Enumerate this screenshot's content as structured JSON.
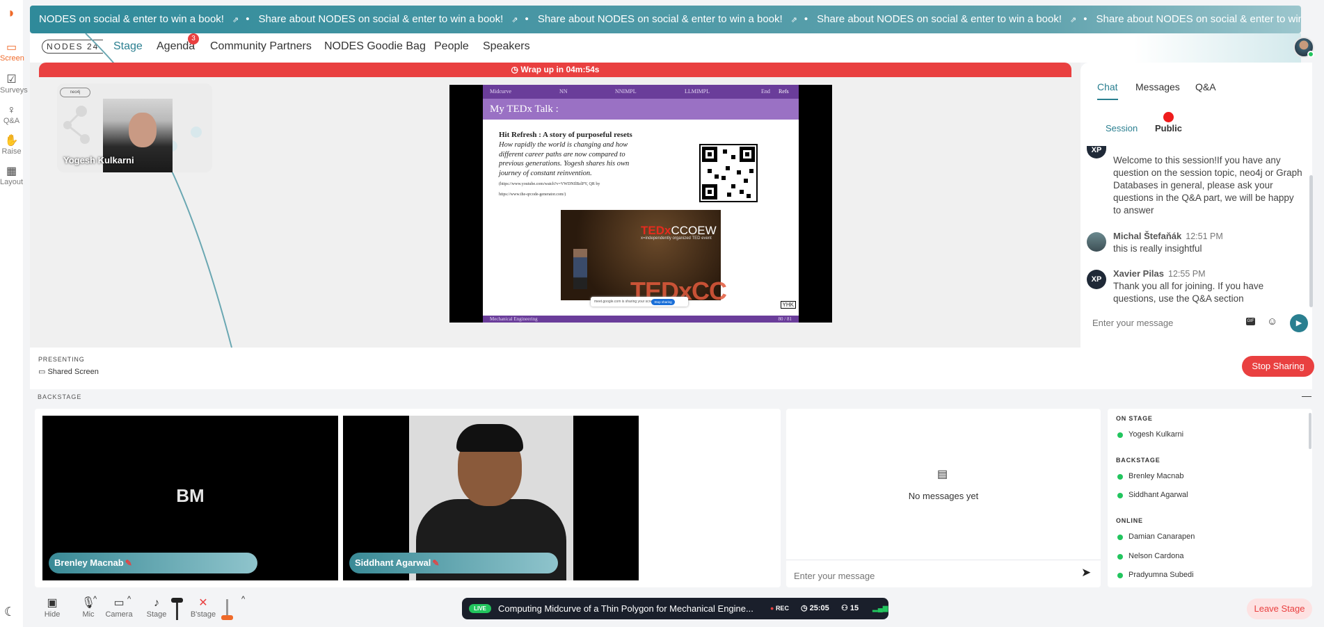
{
  "ticker": {
    "items": [
      "NODES on social & enter to win a book!",
      "Share about NODES on social & enter to win a book!",
      "Share about NODES on social & enter to win a book!",
      "Share about NODES on social & enter to win a book!",
      "Share about NODES on social & enter to win a book!"
    ]
  },
  "rail": {
    "items": [
      {
        "label": "Screen",
        "icon": "screen-icon"
      },
      {
        "label": "Surveys",
        "icon": "surveys-icon"
      },
      {
        "label": "Q&A",
        "icon": "qa-icon"
      },
      {
        "label": "Raise",
        "icon": "hand-icon"
      },
      {
        "label": "Layout",
        "icon": "layout-icon"
      }
    ]
  },
  "header": {
    "logo": "NODES 24",
    "nav": [
      "Stage",
      "Agenda",
      "Community Partners",
      "NODES Goodie Bag",
      "People",
      "Speakers"
    ],
    "agenda_badge": "3"
  },
  "stage": {
    "wrap_up": "Wrap up in 04m:54s",
    "presenter_name": "Yogesh Kulkarni",
    "slide": {
      "top_nav": [
        "Midcurve",
        "NN",
        "NNIMPL",
        "LLMIMPL",
        "End",
        "Refs"
      ],
      "title": "My TEDx Talk :",
      "heading": "Hit Refresh : A story of purposeful resets",
      "body": "How rapidly the world is changing and how different career paths are now compared to previous generations. Yogesh shares his own journey of constant reinvention.",
      "link1": "(https://www.youtube.com/watch?v=VWDNIlBzlPY, QR by",
      "link2": "https://www.the-qrcode-generator.com/)",
      "ted_logo": "TEDx",
      "ted_name": "CCOEW",
      "ted_sub": "x=independently organized TED event",
      "ted_stage": "TEDxCC",
      "share_text": "meet.google.com is sharing your screen",
      "share_btn": "Stop sharing",
      "footer_left": "Mechanical Engineering",
      "footer_right": "80 / 81",
      "corner": "YHK"
    }
  },
  "chat": {
    "tabs": [
      "Chat",
      "Messages",
      "Q&A"
    ],
    "subtabs": [
      "Session",
      "Public"
    ],
    "messages": [
      {
        "initials": "XP",
        "name": "",
        "time": "",
        "text": "Welcome to this session!If you have any question on the session topic, neo4j or Graph Databases in general, please ask your questions in the Q&A part, we will be happy to answer"
      },
      {
        "initials": "",
        "name": "Michal Štefaňák",
        "time": "12:51 PM",
        "text": "this is really insightful"
      },
      {
        "initials": "XP",
        "name": "Xavier Pilas",
        "time": "12:55 PM",
        "text": "Thank you all for joining. If you have questions, use the Q&A section"
      }
    ],
    "input_placeholder": "Enter your message",
    "gif": "GIF"
  },
  "presenting": {
    "label": "PRESENTING",
    "value": "Shared Screen",
    "stop_btn": "Stop Sharing"
  },
  "backstage": {
    "label": "BACKSTAGE",
    "tiles": [
      {
        "initials": "BM",
        "name": "Brenley Macnab"
      },
      {
        "initials": "",
        "name": "Siddhant Agarwal"
      }
    ],
    "no_messages": "No messages yet",
    "input_placeholder": "Enter your message",
    "people": {
      "on_stage_label": "ON STAGE",
      "on_stage": [
        "Yogesh Kulkarni"
      ],
      "backstage_label": "BACKSTAGE",
      "backstage": [
        "Brenley Macnab",
        "Siddhant Agarwal"
      ],
      "online_label": "ONLINE",
      "online": [
        "Damian Canarapen",
        "Nelson Cardona",
        "Pradyumna Subedi"
      ]
    }
  },
  "controls": {
    "items": [
      "Hide",
      "Mic",
      "Camera",
      "Stage",
      "B'stage"
    ],
    "live_tag": "LIVE",
    "session_title": "Computing Midcurve of a Thin Polygon for Mechanical Engine...",
    "rec": "REC",
    "timer": "25:05",
    "attendees": "15",
    "leave_btn": "Leave Stage"
  },
  "colors": {
    "accent": "#2a7f90",
    "danger": "#e94040",
    "live": "#22c55e"
  }
}
